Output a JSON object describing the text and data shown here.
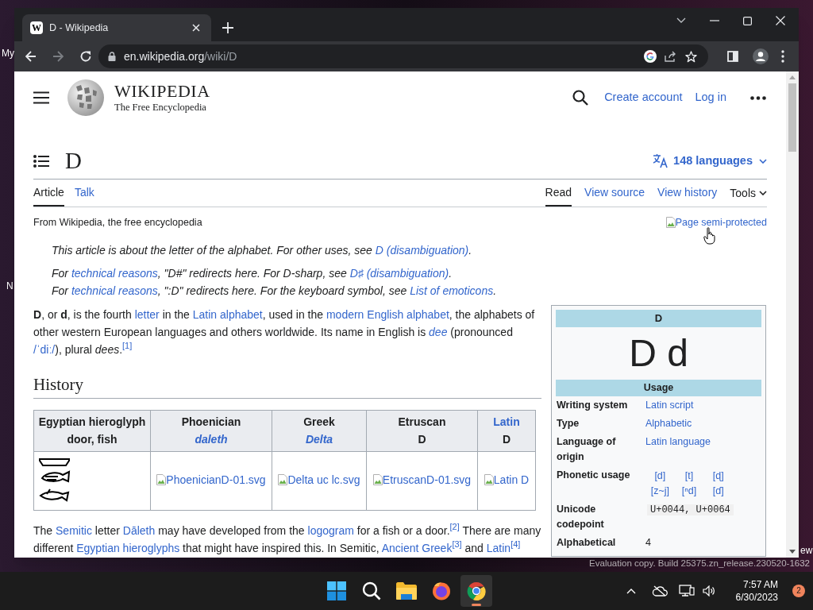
{
  "desktop": {
    "icon_labels": [
      "My",
      "N",
      "ew"
    ],
    "watermark": "Evaluation copy. Build 25375.zn_release.230520-1632"
  },
  "browser": {
    "tab": {
      "title": "D - Wikipedia",
      "favicon": "W",
      "selected": true
    },
    "address": {
      "host": "en.wikipedia.org",
      "path": "/wiki/D"
    }
  },
  "wiki": {
    "wordmark": "WIKIPEDIA",
    "wordmark_tagline": "The Free Encyclopedia",
    "header_links": [
      "Create account",
      "Log in"
    ],
    "title": "D",
    "languages": "148 languages",
    "tabs_left": [
      {
        "label": "Article",
        "selected": true
      },
      {
        "label": "Talk",
        "selected": false
      }
    ],
    "tabs_right": [
      {
        "label": "Read",
        "selected": true
      },
      {
        "label": "View source",
        "selected": false
      },
      {
        "label": "View history",
        "selected": false
      }
    ],
    "tools": "Tools",
    "site_sub": "From Wikipedia, the free encyclopedia",
    "protection_image_alt": "Page semi-protected",
    "hatnotes": [
      [
        {
          "kind": "text",
          "text": "This article is about the letter of the alphabet. For other uses, see "
        },
        {
          "kind": "link",
          "text": "D (disambiguation)"
        },
        {
          "kind": "text",
          "text": "."
        }
      ],
      [
        {
          "kind": "text",
          "text": "For "
        },
        {
          "kind": "link",
          "text": "technical reasons"
        },
        {
          "kind": "text",
          "text": ", \"D#\" redirects here. For D-sharp, see "
        },
        {
          "kind": "link",
          "text": "D♯ (disambiguation)"
        },
        {
          "kind": "text",
          "text": "."
        }
      ],
      [
        {
          "kind": "text",
          "text": "For "
        },
        {
          "kind": "link",
          "text": "technical reasons"
        },
        {
          "kind": "text",
          "text": ", \":D\" redirects here. For the keyboard symbol, see "
        },
        {
          "kind": "link",
          "text": "List of emoticons"
        },
        {
          "kind": "text",
          "text": "."
        }
      ]
    ],
    "intro": [
      {
        "kind": "text",
        "text": "**D**, or **d**, is the fourth "
      },
      {
        "kind": "link",
        "text": "letter"
      },
      {
        "kind": "text",
        "text": " in the "
      },
      {
        "kind": "link",
        "text": "Latin alphabet"
      },
      {
        "kind": "text",
        "text": ", used in the "
      },
      {
        "kind": "link",
        "text": "modern English alphabet"
      },
      {
        "kind": "text",
        "text": ", the alphabets of other western European languages and others worldwide. Its name in English is "
      },
      {
        "kind": "link",
        "text": "*dee*"
      },
      {
        "kind": "text",
        "text": " (pronounced "
      },
      {
        "kind": "link",
        "text": "/ˈdiː/"
      },
      {
        "kind": "text",
        "text": "), plural *dees*."
      },
      {
        "kind": "ref",
        "text": "[1]"
      }
    ],
    "section_heading": "History",
    "table": {
      "header": [
        [
          {
            "kind": "text",
            "text": "Egyptian hieroglyph"
          },
          {
            "kind": "text",
            "text": "door, fish"
          }
        ],
        [
          {
            "kind": "text",
            "text": "Phoenician"
          },
          {
            "kind": "link",
            "text": "*daleth*"
          }
        ],
        [
          {
            "kind": "text",
            "text": "Greek"
          },
          {
            "kind": "link",
            "text": "*Delta*"
          }
        ],
        [
          {
            "kind": "text",
            "text": "Etruscan"
          },
          {
            "kind": "text",
            "text": "D"
          }
        ],
        [
          {
            "kind": "link",
            "text": "Latin"
          },
          {
            "kind": "text",
            "text": "D"
          }
        ]
      ],
      "cells": [
        {
          "kind": "hieroglyph"
        },
        {
          "kind": "broken_image",
          "alt": "PhoenicianD-01.svg"
        },
        {
          "kind": "broken_image",
          "alt": "Delta uc lc.svg"
        },
        {
          "kind": "broken_image",
          "alt": "EtruscanD-01.svg"
        },
        {
          "kind": "broken_image",
          "alt": "Latin D"
        }
      ]
    },
    "history_paragraph": [
      {
        "kind": "text",
        "text": "The "
      },
      {
        "kind": "link",
        "text": "Semitic"
      },
      {
        "kind": "text",
        "text": " letter "
      },
      {
        "kind": "link",
        "text": "Dāleth"
      },
      {
        "kind": "text",
        "text": " may have developed from the "
      },
      {
        "kind": "link",
        "text": "logogram"
      },
      {
        "kind": "text",
        "text": " for a fish or a door."
      },
      {
        "kind": "ref",
        "text": "[2]"
      },
      {
        "kind": "text",
        "text": " There are many different "
      },
      {
        "kind": "link",
        "text": "Egyptian hieroglyphs"
      },
      {
        "kind": "text",
        "text": " that might have inspired this. In Semitic, "
      },
      {
        "kind": "link",
        "text": "Ancient Greek"
      },
      {
        "kind": "ref",
        "text": "[3]"
      },
      {
        "kind": "text",
        "text": " and "
      },
      {
        "kind": "link",
        "text": "Latin"
      },
      {
        "kind": "ref",
        "text": "[4]"
      }
    ],
    "infobox": {
      "title": "D",
      "glyphs": "D d",
      "section": "Usage",
      "rows": [
        {
          "label": "Writing system",
          "kind": "link",
          "value": "Latin script"
        },
        {
          "label": "Type",
          "kind": "link",
          "value": "Alphabetic"
        },
        {
          "label": "Language of origin",
          "kind": "link",
          "value": "Latin language"
        },
        {
          "label": "Phonetic usage",
          "kind": "grid",
          "values": [
            "[d]",
            "[t]",
            "[ɖ]",
            "[z~j]",
            "[ⁿd]",
            "[ɗ]"
          ]
        },
        {
          "label": "Unicode codepoint",
          "kind": "code",
          "value": "U+0044, U+0064"
        },
        {
          "label": "Alphabetical",
          "kind": "text",
          "value": "4"
        }
      ]
    }
  },
  "taskbar": {
    "apps": [
      {
        "kind": "start",
        "selected": false
      },
      {
        "kind": "search",
        "selected": false
      },
      {
        "kind": "files",
        "selected": false
      },
      {
        "kind": "firefox",
        "selected": false
      },
      {
        "kind": "chrome",
        "selected": true
      }
    ],
    "time": "7:57 AM",
    "date": "6/30/2023",
    "notifications": "2"
  }
}
